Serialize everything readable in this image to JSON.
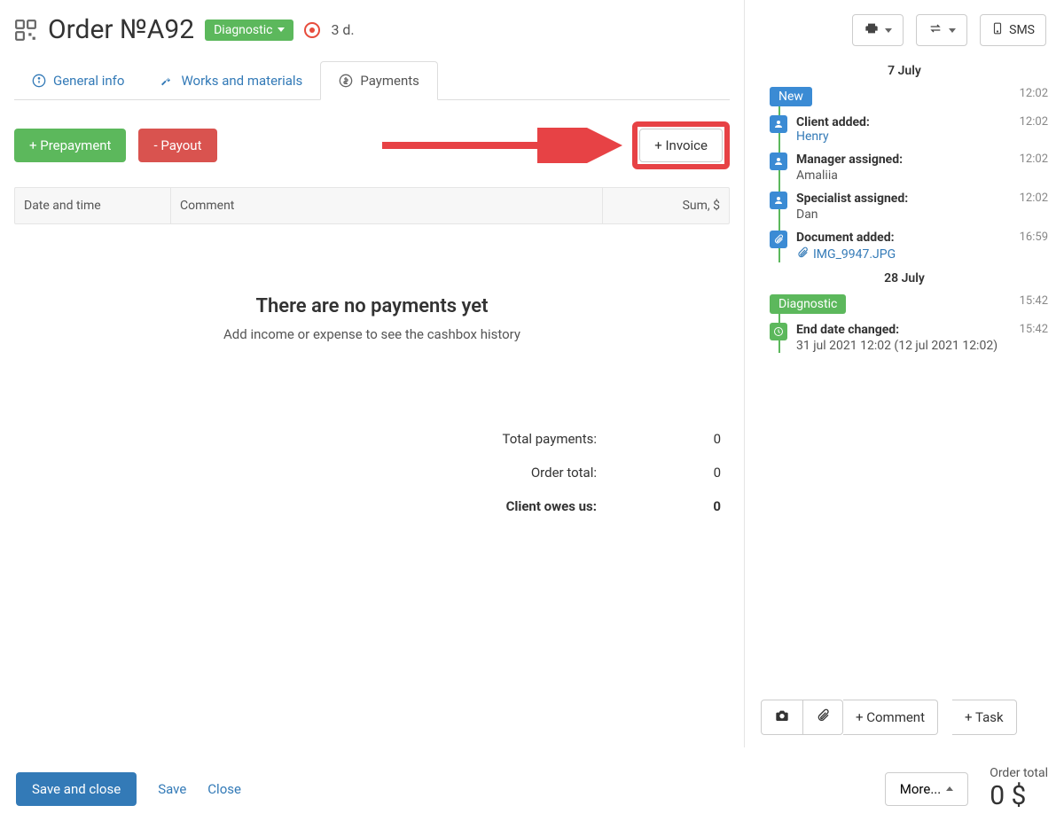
{
  "header": {
    "title": "Order №A92",
    "status": "Diagnostic",
    "duration": "3 d."
  },
  "tabs": {
    "general": "General info",
    "works": "Works and materials",
    "payments": "Payments"
  },
  "actions": {
    "prepayment": "+ Prepayment",
    "payout": "- Payout",
    "invoice": "+ Invoice"
  },
  "table": {
    "columns": {
      "date": "Date and time",
      "comment": "Comment",
      "sum": "Sum, $"
    },
    "empty_title": "There are no payments yet",
    "empty_sub": "Add income or expense to see the cashbox history"
  },
  "totals": {
    "total_payments_label": "Total payments:",
    "total_payments_value": "0",
    "order_total_label": "Order total:",
    "order_total_value": "0",
    "client_owes_label": "Client owes us:",
    "client_owes_value": "0"
  },
  "sidebar": {
    "sms": "SMS",
    "timeline": {
      "date1": "7 July",
      "new_badge": "New",
      "new_time": "12:02",
      "client_added_label": "Client added:",
      "client_added_name": "Henry",
      "client_added_time": "12:02",
      "manager_label": "Manager assigned:",
      "manager_name": "Amaliia",
      "manager_time": "12:02",
      "specialist_label": "Specialist assigned:",
      "specialist_name": "Dan",
      "specialist_time": "12:02",
      "document_label": "Document added:",
      "document_name": "IMG_9947.JPG",
      "document_time": "16:59",
      "date2": "28 July",
      "diag_badge": "Diagnostic",
      "diag_time": "15:42",
      "end_date_label": "End date changed:",
      "end_date_text": "31 jul 2021 12:02 (12 jul 2021 12:02)",
      "end_date_time": "15:42"
    },
    "actions": {
      "comment": "+ Comment",
      "task": "+ Task"
    }
  },
  "footer": {
    "save_close": "Save and close",
    "save": "Save",
    "close": "Close",
    "more": "More...",
    "order_total_label": "Order total",
    "order_total_value": "0 $"
  }
}
